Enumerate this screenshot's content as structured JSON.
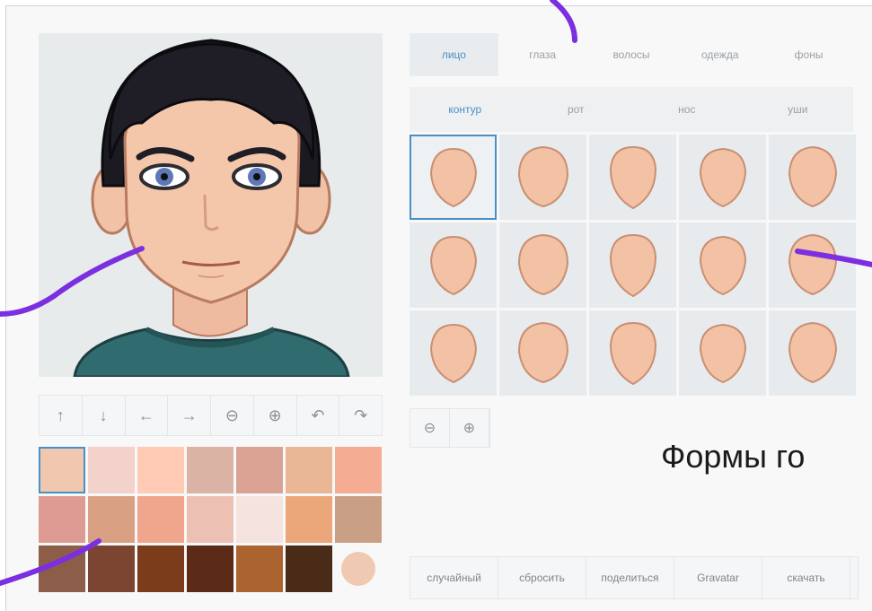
{
  "tabs": [
    {
      "label": "лицо",
      "active": true
    },
    {
      "label": "глаза",
      "active": false
    },
    {
      "label": "волосы",
      "active": false
    },
    {
      "label": "одежда",
      "active": false
    },
    {
      "label": "фоны",
      "active": false
    }
  ],
  "subtabs": [
    {
      "label": "контур",
      "active": true
    },
    {
      "label": "рот",
      "active": false
    },
    {
      "label": "нос",
      "active": false
    },
    {
      "label": "уши",
      "active": false
    }
  ],
  "toolbar": {
    "icons": [
      "arrow-up-icon",
      "arrow-down-icon",
      "arrow-left-icon",
      "arrow-right-icon",
      "zoom-out-icon",
      "zoom-in-icon",
      "undo-icon",
      "redo-icon"
    ],
    "glyphs": [
      "↑",
      "↓",
      "←",
      "→",
      "⊖",
      "⊕",
      "↶",
      "↷"
    ]
  },
  "zoom": {
    "glyphs": [
      "⊖",
      "⊕"
    ]
  },
  "skin_palette": [
    "#f0c8b0",
    "#f3d2cc",
    "#ffcbb5",
    "#dbb3a4",
    "#d9a293",
    "#e9b795",
    "#f4ad93",
    "#de9b93",
    "#d9a084",
    "#f0a58d",
    "#ecc1b4",
    "#f5e3e0",
    "#eba679",
    "#c99f85",
    "#8c5e4a",
    "#7b4531",
    "#7b3c1b",
    "#5c2b17",
    "#ab6430",
    "#4a2b18",
    "#f0c9b2"
  ],
  "face_color": "#f3c2a5",
  "face_stroke": "#c98f74",
  "accent_color": "#4a8fc6",
  "annotation_color": "#7b2fe0",
  "overlay_text": "Формы го",
  "actions": [
    "случайный",
    "сбросить",
    "поделиться",
    "Gravatar",
    "скачать"
  ]
}
